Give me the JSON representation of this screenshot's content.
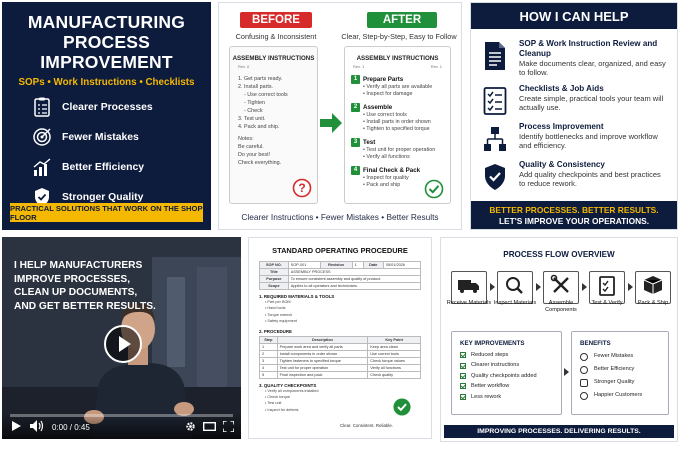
{
  "tile1": {
    "title_line1": "MANUFACTURING",
    "title_line2": "PROCESS IMPROVEMENT",
    "subtitle": "SOPs • Work Instructions • Checklists",
    "features": [
      "Clearer Processes",
      "Fewer Mistakes",
      "Better Efficiency",
      "Stronger Quality"
    ],
    "banner": "PRACTICAL SOLUTIONS THAT WORK ON THE SHOP FLOOR",
    "accent": "#f5b800",
    "navy": "#0d1b3d"
  },
  "tile2": {
    "before_label": "BEFORE",
    "after_label": "AFTER",
    "before_caption": "Confusing & Inconsistent",
    "after_caption": "Clear, Step-by-Step, Easy to Follow",
    "before_doc": {
      "title": "ASSEMBLY INSTRUCTIONS",
      "meta_left": "Rev. 0",
      "meta_right": "Step 1",
      "lines": [
        "1. Get parts ready.",
        "2. Install parts.",
        "- Use correct tools",
        "- Tighten",
        "- Check",
        "3. Test unit.",
        "4. Pack and ship."
      ],
      "notes": [
        "Notes:",
        "Be careful.",
        "Do your best!",
        "Check everything."
      ]
    },
    "after_doc": {
      "title": "ASSEMBLY INSTRUCTIONS",
      "meta_left": "Rev. 1",
      "meta_right": "Rev. 1",
      "steps": [
        {
          "n": "1",
          "title": "Prepare Parts",
          "bullets": [
            "• Verify all parts are available",
            "• Inspect for damage"
          ]
        },
        {
          "n": "2",
          "title": "Assemble",
          "bullets": [
            "• Use correct tools",
            "• Install parts in order shown",
            "• Tighten to specified torque"
          ]
        },
        {
          "n": "3",
          "title": "Test",
          "bullets": [
            "• Test unit for proper operation",
            "• Verify all functions"
          ]
        },
        {
          "n": "4",
          "title": "Final Check & Pack",
          "bullets": [
            "• Inspect for quality",
            "• Pack and ship"
          ]
        }
      ]
    },
    "footer": "Clearer Instructions  •  Fewer Mistakes  •  Better Results",
    "red": "#d72a2a",
    "green": "#20903a"
  },
  "tile3": {
    "title": "HOW I CAN HELP",
    "items": [
      {
        "title": "SOP & Work Instruction Review and Cleanup",
        "desc": "Make documents clear, organized, and easy to follow."
      },
      {
        "title": "Checklists & Job Aids",
        "desc": "Create simple, practical tools your team will actually use."
      },
      {
        "title": "Process Improvement",
        "desc": "Identify bottlenecks and improve workflow and efficiency."
      },
      {
        "title": "Quality & Consistency",
        "desc": "Add quality checkpoints and best practices to reduce rework."
      }
    ],
    "footer_line1": "BETTER PROCESSES. BETTER RESULTS.",
    "footer_line2": "LET'S IMPROVE YOUR OPERATIONS."
  },
  "tile4": {
    "overlay_text": [
      "I HELP MANUFACTURERS",
      "IMPROVE PROCESSES,",
      "CLEAN UP DOCUMENTS,",
      "AND GET BETTER RESULTS."
    ],
    "time": "0:00 / 0:45",
    "progress": 0,
    "icons": [
      "play-icon",
      "volume-icon",
      "settings-icon",
      "theater-icon",
      "fullscreen-icon"
    ]
  },
  "tile5": {
    "title": "STANDARD OPERATING PROCEDURE",
    "header_row1": [
      "SOP NO.",
      "SOP-001",
      "Revision",
      "1",
      "Date",
      "05/01/2026"
    ],
    "header_row2": [
      "Title",
      "ASSEMBLY PROCESS"
    ],
    "header_row3": [
      "Purpose",
      "To ensure consistent assembly and quality of product."
    ],
    "header_row4": [
      "Scope",
      "Applies to all operators and technicians."
    ],
    "section1": "1. REQUIRED MATERIALS & TOOLS",
    "materials": [
      "• Part per BOM",
      "• Hand tools",
      "• Torque wrench",
      "• Safety equipment"
    ],
    "section2": "2. PROCEDURE",
    "proc_headers": [
      "Step",
      "Description",
      "Key Point"
    ],
    "proc_rows": [
      [
        "1",
        "Prepare work area and verify all parts",
        "Keep area clean"
      ],
      [
        "2",
        "Install components in order shown",
        "Use correct tools"
      ],
      [
        "3",
        "Tighten fasteners to specified torque",
        "Check torque values"
      ],
      [
        "4",
        "Test unit for proper operation",
        "Verify all functions"
      ],
      [
        "5",
        "Final inspection and pack",
        "Check quality"
      ]
    ],
    "section3": "3. QUALITY CHECKPOINTS",
    "quality": [
      "• Verify all components installed",
      "• Check torque",
      "• Test unit",
      "• Inspect for defects"
    ],
    "footer_note": "Clear. Consistent. Reliable."
  },
  "tile6": {
    "title": "PROCESS FLOW OVERVIEW",
    "steps": [
      {
        "label": "Receive Materials",
        "icon": "truck-icon"
      },
      {
        "label": "Inspect Materials",
        "icon": "magnifier-icon"
      },
      {
        "label": "Assemble Components",
        "icon": "tools-icon"
      },
      {
        "label": "Test & Verify",
        "icon": "clipboard-check-icon"
      },
      {
        "label": "Pack & Ship",
        "icon": "box-icon"
      }
    ],
    "improvements_title": "KEY IMPROVEMENTS",
    "improvements": [
      "Reduced steps",
      "Clearer instructions",
      "Quality checkpoints added",
      "Better workflow",
      "Less rework"
    ],
    "benefits_title": "BENEFITS",
    "benefits": [
      "Fewer Mistakes",
      "Better Efficiency",
      "Stronger Quality",
      "Happier Customers"
    ],
    "footer": "IMPROVING PROCESSES. DELIVERING RESULTS."
  }
}
